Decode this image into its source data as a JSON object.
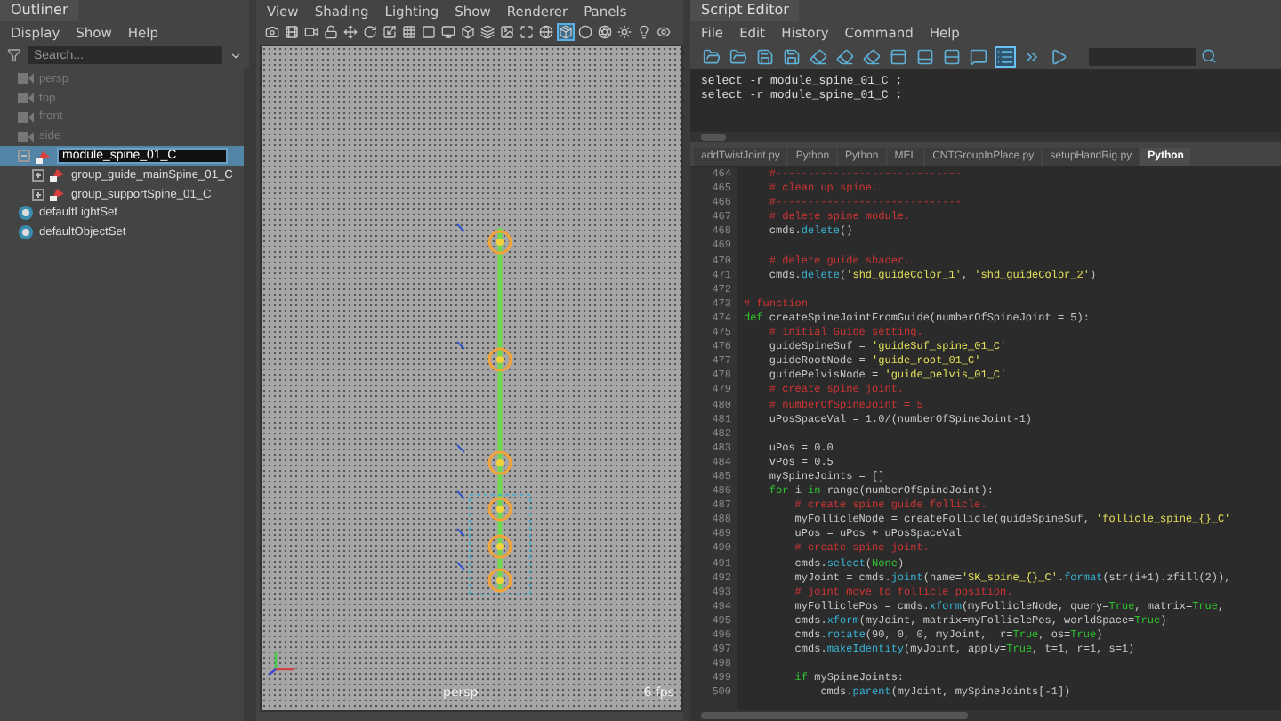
{
  "outliner": {
    "title": "Outliner",
    "menu": [
      "Display",
      "Show",
      "Help"
    ],
    "search": {
      "placeholder": "Search..."
    },
    "items": [
      {
        "label": "persp",
        "kind": "camera",
        "hidden": true,
        "selected": false
      },
      {
        "label": "top",
        "kind": "camera",
        "hidden": true,
        "selected": false
      },
      {
        "label": "front",
        "kind": "camera",
        "hidden": true,
        "selected": false
      },
      {
        "label": "side",
        "kind": "camera",
        "hidden": true,
        "selected": false
      },
      {
        "label": "module_spine_01_C",
        "kind": "transform",
        "hidden": false,
        "selected": true,
        "editing": true,
        "expanded": true,
        "children": [
          {
            "label": "group_guide_mainSpine_01_C",
            "kind": "transform",
            "hidden": false,
            "selected": false,
            "expanded": false
          },
          {
            "label": "group_supportSpine_01_C",
            "kind": "transform",
            "hidden": false,
            "selected": false,
            "expanded": false
          }
        ]
      },
      {
        "label": "defaultLightSet",
        "kind": "set",
        "hidden": false,
        "selected": false
      },
      {
        "label": "defaultObjectSet",
        "kind": "set",
        "hidden": false,
        "selected": false
      }
    ]
  },
  "viewport": {
    "menu": [
      "View",
      "Shading",
      "Lighting",
      "Show",
      "Renderer",
      "Panels"
    ],
    "toolbar": [
      {
        "kind": "camera",
        "selected": false
      },
      {
        "kind": "film",
        "selected": false
      },
      {
        "kind": "video",
        "selected": false
      },
      {
        "kind": "lock",
        "selected": false
      },
      {
        "kind": "move",
        "selected": false
      },
      {
        "kind": "rotate",
        "selected": false
      },
      {
        "kind": "scale",
        "selected": false
      },
      {
        "kind": "grid",
        "selected": false
      },
      {
        "kind": "square",
        "selected": false
      },
      {
        "kind": "monitor",
        "selected": false
      },
      {
        "kind": "box",
        "selected": false
      },
      {
        "kind": "layers",
        "selected": false
      },
      {
        "kind": "image",
        "selected": false
      },
      {
        "kind": "maximize",
        "selected": false
      },
      {
        "kind": "globe",
        "selected": false
      },
      {
        "kind": "cube",
        "selected": true
      },
      {
        "kind": "circle",
        "selected": false
      },
      {
        "kind": "aperture",
        "selected": false
      },
      {
        "kind": "sun",
        "selected": false
      },
      {
        "kind": "lightbulb",
        "selected": false
      },
      {
        "kind": "eye",
        "selected": false
      }
    ],
    "camera_label": "persp",
    "fps": "6 fps"
  },
  "script_editor": {
    "title": "Script Editor",
    "menu": [
      "File",
      "Edit",
      "History",
      "Command",
      "Help"
    ],
    "toolbar": [
      {
        "kind": "open",
        "selected": false
      },
      {
        "kind": "open",
        "selected": false
      },
      {
        "kind": "save",
        "selected": false
      },
      {
        "kind": "save",
        "selected": false
      },
      {
        "kind": "clear",
        "selected": false
      },
      {
        "kind": "clear",
        "selected": false
      },
      {
        "kind": "clear",
        "selected": false
      },
      {
        "kind": "panel-top",
        "selected": false
      },
      {
        "kind": "panel-bottom",
        "selected": false
      },
      {
        "kind": "rows",
        "selected": false
      },
      {
        "kind": "echo",
        "selected": false
      },
      {
        "kind": "list",
        "selected": true
      },
      {
        "kind": "run-selected",
        "selected": false
      },
      {
        "kind": "run",
        "selected": false
      }
    ],
    "history": [
      "select -r module_spine_01_C ;",
      "select -r module_spine_01_C ;"
    ],
    "tabs": [
      {
        "label": "addTwistJoint.py",
        "selected": false
      },
      {
        "label": "Python",
        "selected": false
      },
      {
        "label": "Python",
        "selected": false
      },
      {
        "label": "MEL",
        "selected": false
      },
      {
        "label": "CNTGroupInPlace.py",
        "selected": false
      },
      {
        "label": "setupHandRig.py",
        "selected": false
      },
      {
        "label": "Python",
        "selected": true
      }
    ],
    "code": [
      {
        "number": "464",
        "tokens": [
          {
            "kind": "comment",
            "text": "    #-----------------------------"
          }
        ]
      },
      {
        "number": "465",
        "tokens": [
          {
            "kind": "comment",
            "text": "    # clean up spine."
          }
        ]
      },
      {
        "number": "466",
        "tokens": [
          {
            "kind": "comment",
            "text": "    #-----------------------------"
          }
        ]
      },
      {
        "number": "467",
        "tokens": [
          {
            "kind": "comment",
            "text": "    # delete spine module."
          }
        ]
      },
      {
        "number": "468",
        "tokens": [
          {
            "kind": "plain",
            "text": "    cmds."
          },
          {
            "kind": "function",
            "text": "delete"
          },
          {
            "kind": "plain",
            "text": "()"
          }
        ]
      },
      {
        "number": "469"
      },
      {
        "number": "470",
        "tokens": [
          {
            "kind": "comment",
            "text": "    # delete guide shader."
          }
        ]
      },
      {
        "number": "471",
        "tokens": [
          {
            "kind": "plain",
            "text": "    cmds."
          },
          {
            "kind": "function",
            "text": "delete"
          },
          {
            "kind": "plain",
            "text": "("
          },
          {
            "kind": "string",
            "text": "'shd_guideColor_1'"
          },
          {
            "kind": "plain",
            "text": ", "
          },
          {
            "kind": "string",
            "text": "'shd_guideColor_2'"
          },
          {
            "kind": "plain",
            "text": ")"
          }
        ]
      },
      {
        "number": "472"
      },
      {
        "number": "473",
        "tokens": [
          {
            "kind": "comment",
            "text": "# function"
          }
        ]
      },
      {
        "number": "474",
        "tokens": [
          {
            "kind": "keyword",
            "text": "def"
          },
          {
            "kind": "plain",
            "text": " createSpineJointFromGuide(numberOfSpineJoint = 5):"
          }
        ]
      },
      {
        "number": "475",
        "tokens": [
          {
            "kind": "comment",
            "text": "    # initial Guide setting."
          }
        ]
      },
      {
        "number": "476",
        "tokens": [
          {
            "kind": "plain",
            "text": "    guideSpineSuf = "
          },
          {
            "kind": "string",
            "text": "'guideSuf_spine_01_C'"
          }
        ]
      },
      {
        "number": "477",
        "tokens": [
          {
            "kind": "plain",
            "text": "    guideRootNode = "
          },
          {
            "kind": "string",
            "text": "'guide_root_01_C'"
          }
        ]
      },
      {
        "number": "478",
        "tokens": [
          {
            "kind": "plain",
            "text": "    guidePelvisNode = "
          },
          {
            "kind": "string",
            "text": "'guide_pelvis_01_C'"
          }
        ]
      },
      {
        "number": "479",
        "tokens": [
          {
            "kind": "comment",
            "text": "    # create spine joint."
          }
        ]
      },
      {
        "number": "480",
        "tokens": [
          {
            "kind": "comment",
            "text": "    # numberOfSpineJoint = 5"
          }
        ]
      },
      {
        "number": "481",
        "tokens": [
          {
            "kind": "plain",
            "text": "    uPosSpaceVal = 1.0/(numberOfSpineJoint-1)"
          }
        ]
      },
      {
        "number": "482"
      },
      {
        "number": "483",
        "tokens": [
          {
            "kind": "plain",
            "text": "    uPos = 0.0"
          }
        ]
      },
      {
        "number": "484",
        "tokens": [
          {
            "kind": "plain",
            "text": "    vPos = 0.5"
          }
        ]
      },
      {
        "number": "485",
        "tokens": [
          {
            "kind": "plain",
            "text": "    mySpineJoints = []"
          }
        ]
      },
      {
        "number": "486",
        "tokens": [
          {
            "kind": "keyword",
            "text": "    for"
          },
          {
            "kind": "plain",
            "text": " i "
          },
          {
            "kind": "keyword",
            "text": "in"
          },
          {
            "kind": "plain",
            "text": " range(numberOfSpineJoint):"
          }
        ]
      },
      {
        "number": "487",
        "tokens": [
          {
            "kind": "comment",
            "text": "        # create spine guide follicle."
          }
        ]
      },
      {
        "number": "488",
        "tokens": [
          {
            "kind": "plain",
            "text": "        myFollicleNode = createFollicle(guideSpineSuf, "
          },
          {
            "kind": "string",
            "text": "'follicle_spine_{}_C'"
          }
        ]
      },
      {
        "number": "489",
        "tokens": [
          {
            "kind": "plain",
            "text": "        uPos = uPos + uPosSpaceVal"
          }
        ]
      },
      {
        "number": "490",
        "tokens": [
          {
            "kind": "comment",
            "text": "        # create spine joint."
          }
        ]
      },
      {
        "number": "491",
        "tokens": [
          {
            "kind": "plain",
            "text": "        cmds."
          },
          {
            "kind": "function",
            "text": "select"
          },
          {
            "kind": "plain",
            "text": "("
          },
          {
            "kind": "keyword",
            "text": "None"
          },
          {
            "kind": "plain",
            "text": ")"
          }
        ]
      },
      {
        "number": "492",
        "tokens": [
          {
            "kind": "plain",
            "text": "        myJoint = cmds."
          },
          {
            "kind": "function",
            "text": "joint"
          },
          {
            "kind": "plain",
            "text": "(name="
          },
          {
            "kind": "string",
            "text": "'SK_spine_{}_C'"
          },
          {
            "kind": "plain",
            "text": "."
          },
          {
            "kind": "function",
            "text": "format"
          },
          {
            "kind": "plain",
            "text": "(str(i+1).zfill(2)),"
          }
        ]
      },
      {
        "number": "493",
        "tokens": [
          {
            "kind": "comment",
            "text": "        # joint move to follicle position."
          }
        ]
      },
      {
        "number": "494",
        "tokens": [
          {
            "kind": "plain",
            "text": "        myFolliclePos = cmds."
          },
          {
            "kind": "function",
            "text": "xform"
          },
          {
            "kind": "plain",
            "text": "(myFollicleNode, query="
          },
          {
            "kind": "keyword",
            "text": "True"
          },
          {
            "kind": "plain",
            "text": ", matrix="
          },
          {
            "kind": "keyword",
            "text": "True"
          },
          {
            "kind": "plain",
            "text": ","
          }
        ]
      },
      {
        "number": "495",
        "tokens": [
          {
            "kind": "plain",
            "text": "        cmds."
          },
          {
            "kind": "function",
            "text": "xform"
          },
          {
            "kind": "plain",
            "text": "(myJoint, matrix=myFolliclePos, worldSpace="
          },
          {
            "kind": "keyword",
            "text": "True"
          },
          {
            "kind": "plain",
            "text": ")"
          }
        ]
      },
      {
        "number": "496",
        "tokens": [
          {
            "kind": "plain",
            "text": "        cmds."
          },
          {
            "kind": "function",
            "text": "rotate"
          },
          {
            "kind": "plain",
            "text": "(90, 0, 0, myJoint,  r="
          },
          {
            "kind": "keyword",
            "text": "True"
          },
          {
            "kind": "plain",
            "text": ", os="
          },
          {
            "kind": "keyword",
            "text": "True"
          },
          {
            "kind": "plain",
            "text": ")"
          }
        ]
      },
      {
        "number": "497",
        "tokens": [
          {
            "kind": "plain",
            "text": "        cmds."
          },
          {
            "kind": "function",
            "text": "makeIdentity"
          },
          {
            "kind": "plain",
            "text": "(myJoint, apply="
          },
          {
            "kind": "keyword",
            "text": "True"
          },
          {
            "kind": "plain",
            "text": ", t=1, r=1, s=1)"
          }
        ]
      },
      {
        "number": "498"
      },
      {
        "number": "499",
        "tokens": [
          {
            "kind": "keyword",
            "text": "        if"
          },
          {
            "kind": "plain",
            "text": " mySpineJoints:"
          }
        ]
      },
      {
        "number": "500",
        "tokens": [
          {
            "kind": "plain",
            "text": "            cmds."
          },
          {
            "kind": "function",
            "text": "parent"
          },
          {
            "kind": "plain",
            "text": "(myJoint, mySpineJoints[-1])"
          }
        ]
      }
    ]
  }
}
